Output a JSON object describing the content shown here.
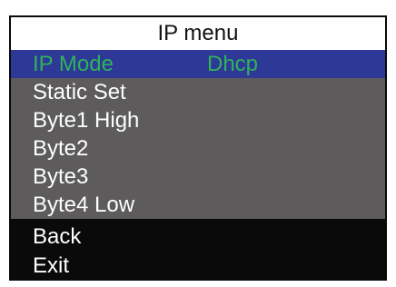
{
  "header": {
    "title": "IP menu"
  },
  "menu": {
    "items": [
      {
        "label": "IP Mode",
        "value": "Dhcp"
      },
      {
        "label": "Static Set"
      },
      {
        "label": "Byte1 High"
      },
      {
        "label": "Byte2"
      },
      {
        "label": "Byte3"
      },
      {
        "label": "Byte4 Low"
      }
    ],
    "selected_index": 0
  },
  "footer": {
    "back_label": "Back",
    "exit_label": "Exit"
  },
  "colors": {
    "screen_bg": "#0a0a0a",
    "title_bg": "#ffffff",
    "menu_bg": "#5d5b5b",
    "selected_bg": "#2d3897",
    "selected_text": "#2fb35a"
  }
}
